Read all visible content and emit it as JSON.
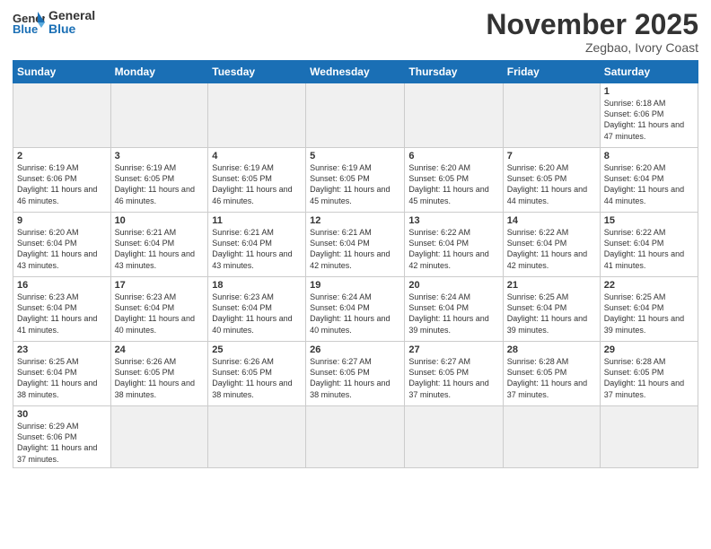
{
  "logo": {
    "text_general": "General",
    "text_blue": "Blue"
  },
  "header": {
    "month": "November 2025",
    "location": "Zegbao, Ivory Coast"
  },
  "weekdays": [
    "Sunday",
    "Monday",
    "Tuesday",
    "Wednesday",
    "Thursday",
    "Friday",
    "Saturday"
  ],
  "weeks": [
    [
      {
        "day": "",
        "info": ""
      },
      {
        "day": "",
        "info": ""
      },
      {
        "day": "",
        "info": ""
      },
      {
        "day": "",
        "info": ""
      },
      {
        "day": "",
        "info": ""
      },
      {
        "day": "",
        "info": ""
      },
      {
        "day": "1",
        "info": "Sunrise: 6:18 AM\nSunset: 6:06 PM\nDaylight: 11 hours and 47 minutes."
      }
    ],
    [
      {
        "day": "2",
        "info": "Sunrise: 6:19 AM\nSunset: 6:06 PM\nDaylight: 11 hours and 46 minutes."
      },
      {
        "day": "3",
        "info": "Sunrise: 6:19 AM\nSunset: 6:05 PM\nDaylight: 11 hours and 46 minutes."
      },
      {
        "day": "4",
        "info": "Sunrise: 6:19 AM\nSunset: 6:05 PM\nDaylight: 11 hours and 46 minutes."
      },
      {
        "day": "5",
        "info": "Sunrise: 6:19 AM\nSunset: 6:05 PM\nDaylight: 11 hours and 45 minutes."
      },
      {
        "day": "6",
        "info": "Sunrise: 6:20 AM\nSunset: 6:05 PM\nDaylight: 11 hours and 45 minutes."
      },
      {
        "day": "7",
        "info": "Sunrise: 6:20 AM\nSunset: 6:05 PM\nDaylight: 11 hours and 44 minutes."
      },
      {
        "day": "8",
        "info": "Sunrise: 6:20 AM\nSunset: 6:04 PM\nDaylight: 11 hours and 44 minutes."
      }
    ],
    [
      {
        "day": "9",
        "info": "Sunrise: 6:20 AM\nSunset: 6:04 PM\nDaylight: 11 hours and 43 minutes."
      },
      {
        "day": "10",
        "info": "Sunrise: 6:21 AM\nSunset: 6:04 PM\nDaylight: 11 hours and 43 minutes."
      },
      {
        "day": "11",
        "info": "Sunrise: 6:21 AM\nSunset: 6:04 PM\nDaylight: 11 hours and 43 minutes."
      },
      {
        "day": "12",
        "info": "Sunrise: 6:21 AM\nSunset: 6:04 PM\nDaylight: 11 hours and 42 minutes."
      },
      {
        "day": "13",
        "info": "Sunrise: 6:22 AM\nSunset: 6:04 PM\nDaylight: 11 hours and 42 minutes."
      },
      {
        "day": "14",
        "info": "Sunrise: 6:22 AM\nSunset: 6:04 PM\nDaylight: 11 hours and 42 minutes."
      },
      {
        "day": "15",
        "info": "Sunrise: 6:22 AM\nSunset: 6:04 PM\nDaylight: 11 hours and 41 minutes."
      }
    ],
    [
      {
        "day": "16",
        "info": "Sunrise: 6:23 AM\nSunset: 6:04 PM\nDaylight: 11 hours and 41 minutes."
      },
      {
        "day": "17",
        "info": "Sunrise: 6:23 AM\nSunset: 6:04 PM\nDaylight: 11 hours and 40 minutes."
      },
      {
        "day": "18",
        "info": "Sunrise: 6:23 AM\nSunset: 6:04 PM\nDaylight: 11 hours and 40 minutes."
      },
      {
        "day": "19",
        "info": "Sunrise: 6:24 AM\nSunset: 6:04 PM\nDaylight: 11 hours and 40 minutes."
      },
      {
        "day": "20",
        "info": "Sunrise: 6:24 AM\nSunset: 6:04 PM\nDaylight: 11 hours and 39 minutes."
      },
      {
        "day": "21",
        "info": "Sunrise: 6:25 AM\nSunset: 6:04 PM\nDaylight: 11 hours and 39 minutes."
      },
      {
        "day": "22",
        "info": "Sunrise: 6:25 AM\nSunset: 6:04 PM\nDaylight: 11 hours and 39 minutes."
      }
    ],
    [
      {
        "day": "23",
        "info": "Sunrise: 6:25 AM\nSunset: 6:04 PM\nDaylight: 11 hours and 38 minutes."
      },
      {
        "day": "24",
        "info": "Sunrise: 6:26 AM\nSunset: 6:05 PM\nDaylight: 11 hours and 38 minutes."
      },
      {
        "day": "25",
        "info": "Sunrise: 6:26 AM\nSunset: 6:05 PM\nDaylight: 11 hours and 38 minutes."
      },
      {
        "day": "26",
        "info": "Sunrise: 6:27 AM\nSunset: 6:05 PM\nDaylight: 11 hours and 38 minutes."
      },
      {
        "day": "27",
        "info": "Sunrise: 6:27 AM\nSunset: 6:05 PM\nDaylight: 11 hours and 37 minutes."
      },
      {
        "day": "28",
        "info": "Sunrise: 6:28 AM\nSunset: 6:05 PM\nDaylight: 11 hours and 37 minutes."
      },
      {
        "day": "29",
        "info": "Sunrise: 6:28 AM\nSunset: 6:05 PM\nDaylight: 11 hours and 37 minutes."
      }
    ],
    [
      {
        "day": "30",
        "info": "Sunrise: 6:29 AM\nSunset: 6:06 PM\nDaylight: 11 hours and 37 minutes."
      },
      {
        "day": "",
        "info": ""
      },
      {
        "day": "",
        "info": ""
      },
      {
        "day": "",
        "info": ""
      },
      {
        "day": "",
        "info": ""
      },
      {
        "day": "",
        "info": ""
      },
      {
        "day": "",
        "info": ""
      }
    ]
  ]
}
